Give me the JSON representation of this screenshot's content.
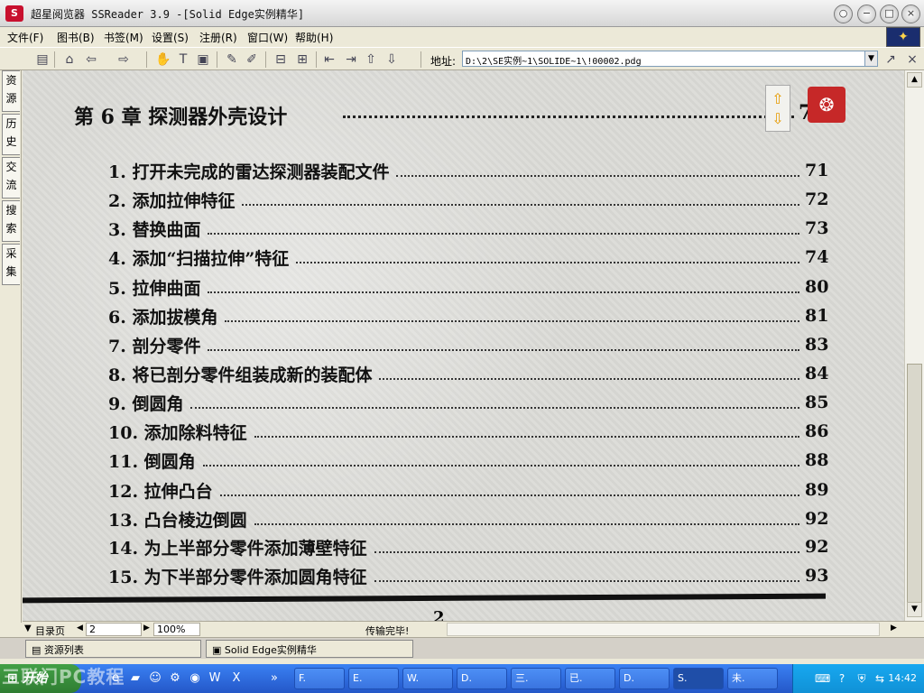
{
  "window": {
    "title": "超星阅览器 SSReader 3.9 -[Solid Edge实例精华]",
    "app_icon": "S",
    "buttons": [
      "restore",
      "minimize",
      "maximize",
      "close"
    ]
  },
  "menu": [
    "文件(F)",
    "图书(B)",
    "书签(M)",
    "设置(S)",
    "注册(R)",
    "窗口(W)",
    "帮助(H)"
  ],
  "toolbar": {
    "address_label": "地址:",
    "address_value": "D:\\2\\SE实例~1\\SOLIDE~1\\!00002.pdg"
  },
  "sidebar_tabs": [
    "资源",
    "历史",
    "交流",
    "搜索",
    "采集"
  ],
  "document": {
    "chapter_title": "第 6 章  探测器外壳设计",
    "chapter_page": "76",
    "entries": [
      {
        "label": "1. 打开未完成的雷达探测器装配文件",
        "page": "71"
      },
      {
        "label": "2. 添加拉伸特征",
        "page": "72"
      },
      {
        "label": "3. 替换曲面",
        "page": "73"
      },
      {
        "label": "4. 添加“扫描拉伸”特征",
        "page": "74"
      },
      {
        "label": "5. 拉伸曲面",
        "page": "80"
      },
      {
        "label": "6. 添加拔模角",
        "page": "81"
      },
      {
        "label": "7. 剖分零件",
        "page": "83"
      },
      {
        "label": "8. 将已剖分零件组装成新的装配体",
        "page": "84"
      },
      {
        "label": "9. 倒圆角",
        "page": "85"
      },
      {
        "label": "10. 添加除料特征",
        "page": "86"
      },
      {
        "label": "11. 倒圆角",
        "page": "88"
      },
      {
        "label": "12. 拉伸凸台",
        "page": "89"
      },
      {
        "label": "13. 凸台棱边倒圆",
        "page": "92"
      },
      {
        "label": "14. 为上半部分零件添加薄壁特征",
        "page": "92"
      },
      {
        "label": "15. 为下半部分零件添加圆角特征",
        "page": "93"
      }
    ],
    "page_number": "2"
  },
  "statusbar": {
    "toc_label": "目录页",
    "page_input": "2",
    "zoom": "100%",
    "status": "传输完毕!"
  },
  "tabs": {
    "resource_tab": "资源列表",
    "book_tab": "Solid Edge实例精华"
  },
  "taskbar": {
    "start": "开始",
    "buttons": [
      "F.",
      "E.",
      "W.",
      "D.",
      "三.",
      "已.",
      "D.",
      "S.",
      "未."
    ],
    "clock": "14:42"
  },
  "watermark": "三联门PC教程"
}
